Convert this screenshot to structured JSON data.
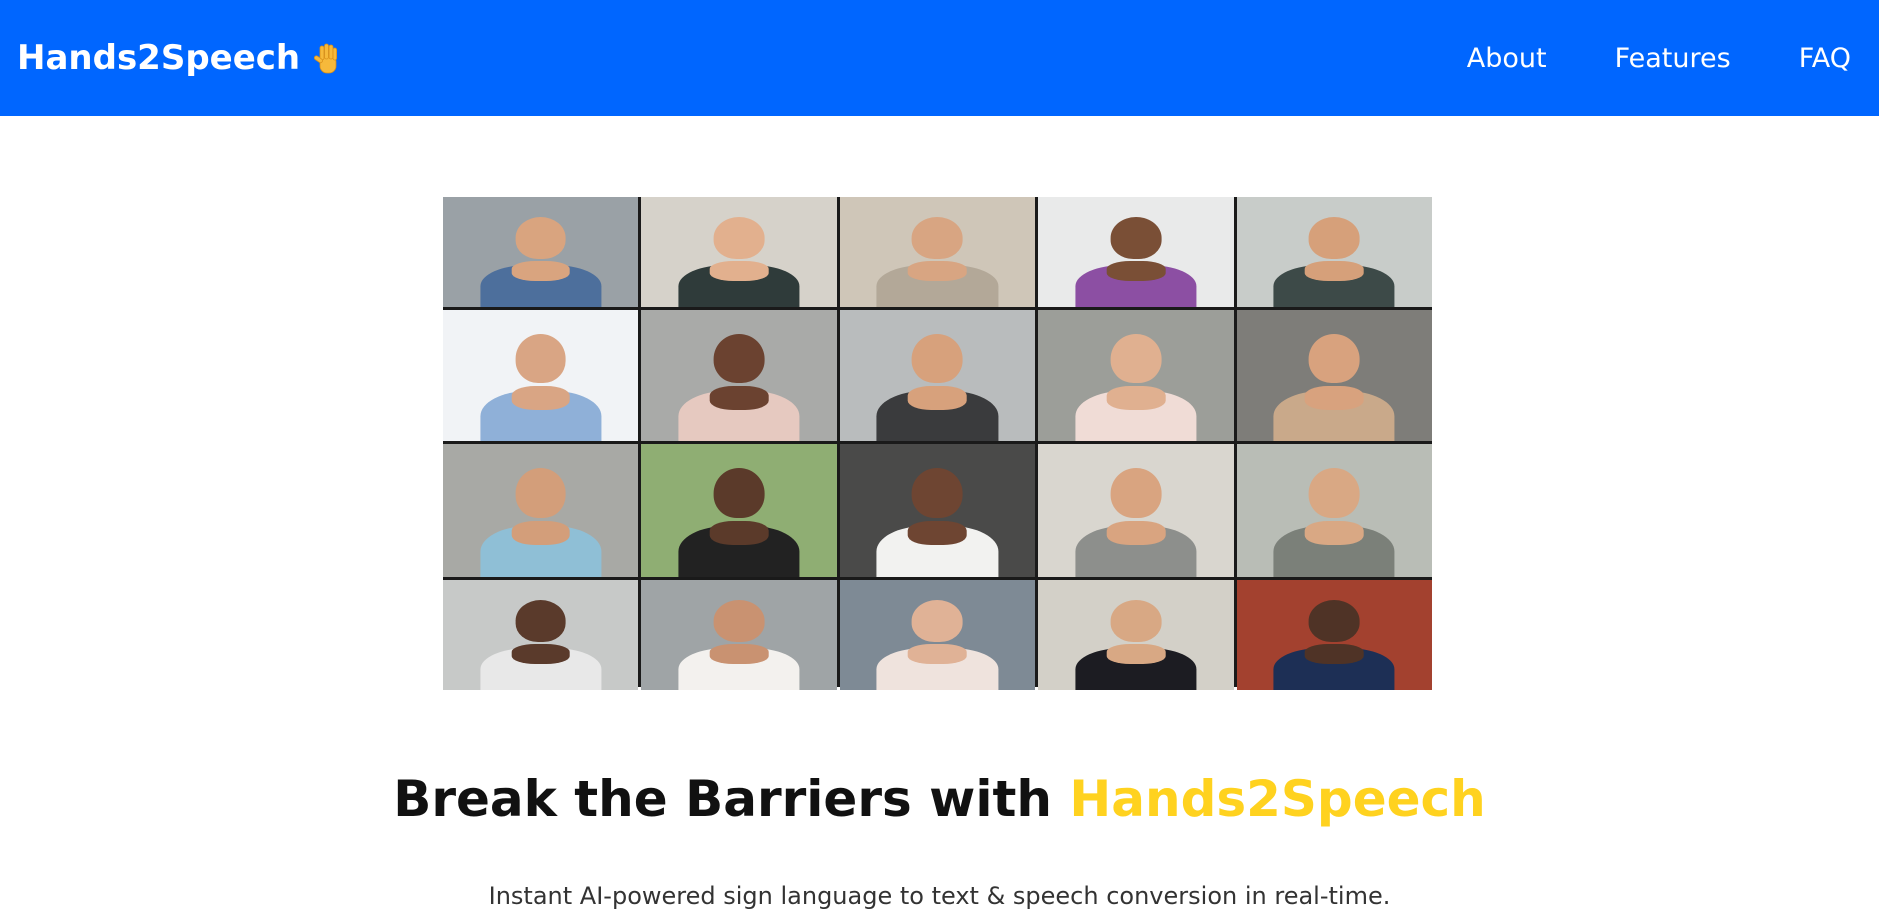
{
  "header": {
    "brand": "Hands2Speech",
    "brand_emoji": "👋",
    "nav": [
      {
        "label": "About"
      },
      {
        "label": "Features"
      },
      {
        "label": "FAQ"
      }
    ]
  },
  "hero": {
    "headline_prefix": "Break the Barriers with",
    "headline_accent": "Hands2Speech",
    "subtitle": "Instant AI-powered sign language to text & speech conversion in real-time."
  },
  "colors": {
    "navbar": "#0066ff",
    "accent": "#ffd21f",
    "headline": "#111111"
  },
  "image": {
    "tiles": [
      {
        "bg": "#9aa1a6",
        "skin": "#d9a47f",
        "shirt": "#4d6f9c"
      },
      {
        "bg": "#d6d2ca",
        "skin": "#e2b08e",
        "shirt": "#2f3b3a"
      },
      {
        "bg": "#cfc6b8",
        "skin": "#d8a582",
        "shirt": "#b3a898"
      },
      {
        "bg": "#e9eaea",
        "skin": "#7a4f36",
        "shirt": "#8c4fa3"
      },
      {
        "bg": "#c8ccc9",
        "skin": "#d6a07a",
        "shirt": "#3d4a48"
      },
      {
        "bg": "#f1f3f6",
        "skin": "#d9a584",
        "shirt": "#8fb0d8"
      },
      {
        "bg": "#a9aaa8",
        "skin": "#6b4230",
        "shirt": "#e6c9c0"
      },
      {
        "bg": "#b9bcbd",
        "skin": "#d7a17c",
        "shirt": "#3a3b3d"
      },
      {
        "bg": "#9c9e99",
        "skin": "#e0b090",
        "shirt": "#f0dcd6"
      },
      {
        "bg": "#7e7d79",
        "skin": "#d8a27e",
        "shirt": "#c9a98a"
      },
      {
        "bg": "#a8a9a5",
        "skin": "#d39e7a",
        "shirt": "#8fbfd6"
      },
      {
        "bg": "#8fae73",
        "skin": "#5b3a2a",
        "shirt": "#222222"
      },
      {
        "bg": "#4a4a49",
        "skin": "#6e4532",
        "shirt": "#f2f2f0"
      },
      {
        "bg": "#d9d6cf",
        "skin": "#d9a480",
        "shirt": "#8d8f8c"
      },
      {
        "bg": "#b9bdb6",
        "skin": "#d9a884",
        "shirt": "#7b8079"
      },
      {
        "bg": "#c7c9c8",
        "skin": "#5a3a2b",
        "shirt": "#e8e8e8"
      },
      {
        "bg": "#9fa4a6",
        "skin": "#c99271",
        "shirt": "#f3f1ee"
      },
      {
        "bg": "#7e8a95",
        "skin": "#e0b296",
        "shirt": "#efe3dd"
      },
      {
        "bg": "#d3d0c8",
        "skin": "#d8a884",
        "shirt": "#1c1c22"
      },
      {
        "bg": "#a3412f",
        "skin": "#4f3326",
        "shirt": "#1d2f55"
      }
    ]
  }
}
